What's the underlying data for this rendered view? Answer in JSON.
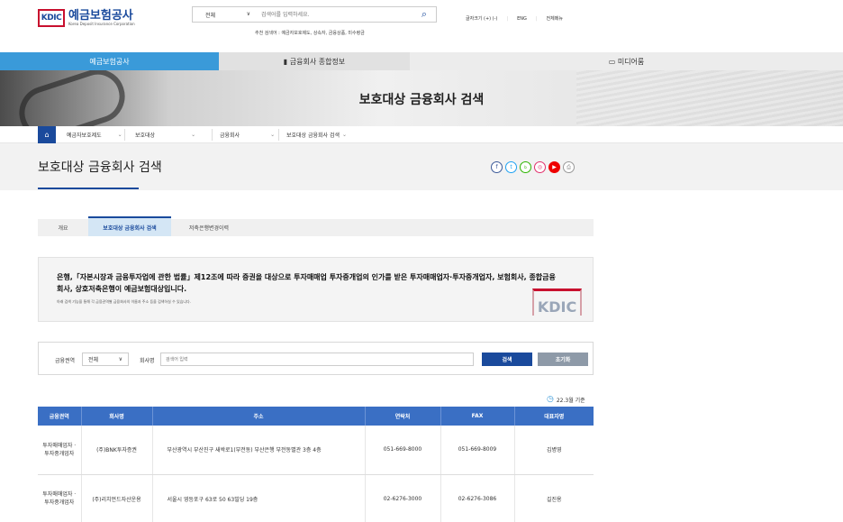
{
  "header": {
    "logo_mark": "KDIC",
    "logo_ko": "예금보험공사",
    "logo_en": "Korea Deposit Insurance Corporation",
    "search_scope": "전체",
    "search_placeholder": "검색어를 입력하세요.",
    "recommended": "추천 검색어 : 예금자보호제도, 상속자, 금융상품, 미수령금",
    "util": [
      "글자크기 (+) (-)",
      "ENG",
      "전체메뉴"
    ]
  },
  "mainnav": {
    "tabs": [
      "예금보험공사",
      "금융회사 종합정보",
      "미디어룸"
    ]
  },
  "banner": {
    "title": "보호대상 금융회사 검색"
  },
  "breadcrumb": [
    "예금자보호제도",
    "보호대상",
    "금융회사",
    "보호대상 금융회사 검색"
  ],
  "page": {
    "title": "보호대상 금융회사 검색",
    "social": [
      "f",
      "t",
      "blog",
      "ig",
      "yt",
      "print"
    ]
  },
  "subtabs": [
    "개요",
    "보호대상 금융회사 검색",
    "저축은행변경이력"
  ],
  "notice": {
    "text": "은행,「자본시장과 금융투자업에 관한 법률」제12조에 따라 증권을 대상으로 투자매매업 투자중개업의 인가를 받은 투자매매업자·투자중개업자, 보험회사, 종합금융회사, 상호저축은행이 예금보험대상입니다.",
    "sub": "아래 검색 기능을 통해 각 금융권역별 금융회사의 이름과 주소 등을 검색하실 수 있습니다.",
    "logo": "KDIC"
  },
  "filter": {
    "sector_label": "금융권역",
    "sector_value": "전체",
    "company_label": "회사명",
    "company_placeholder": "검색어 입력",
    "search_btn": "검색",
    "reset_btn": "초기화"
  },
  "table": {
    "as_of": "22.3월 기준",
    "headers": [
      "금융권역",
      "회사명",
      "주소",
      "연락처",
      "FAX",
      "대표자명"
    ],
    "rows": [
      [
        "투자매매업자 · 투자중개업자",
        "(주)BNK투자증권",
        "부산광역시 부산진구 새싹로1(부전동) 부산은행 부전동별관 3층 4층",
        "051-669-8000",
        "051-669-8009",
        "김병영"
      ],
      [
        "투자매매업자 · 투자중개업자",
        "(주)리치먼드자산운용",
        "서울시 영등포구 63로 50 63빌딩 19층",
        "02-6276-3000",
        "02-6276-3086",
        "길진용"
      ]
    ]
  },
  "colors": {
    "primary": "#1a4a9c",
    "accent": "#3a9ad9",
    "brand_red": "#c8102e"
  }
}
